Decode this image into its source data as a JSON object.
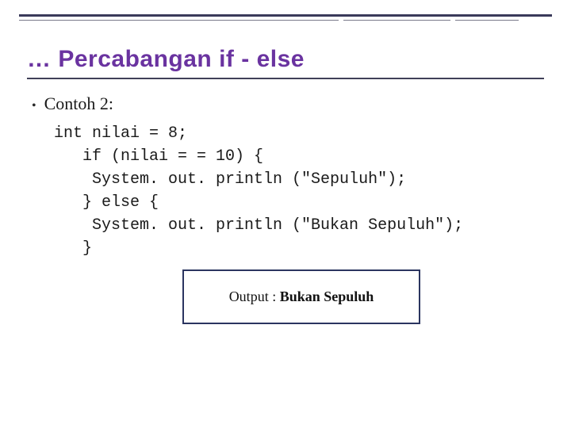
{
  "title": "… Percabangan if - else",
  "bullet": "Contoh 2:",
  "code": {
    "l1": "int nilai = 8;",
    "l2": "   if (nilai = = 10) {",
    "l3": "    System. out. println (\"Sepuluh\");",
    "l4": "   } else {",
    "l5": "    System. out. println (\"Bukan Sepuluh\");",
    "l6": "   }"
  },
  "output": {
    "label": "Output : ",
    "value": "Bukan Sepuluh"
  }
}
